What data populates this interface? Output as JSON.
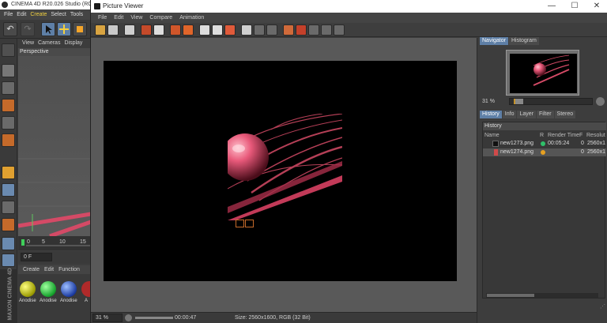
{
  "c4d": {
    "title": "CINEMA 4D R20.026 Studio (RC -",
    "menu": [
      "File",
      "Edit",
      "Create",
      "Select",
      "Tools"
    ],
    "viewport_menu": [
      "View",
      "Cameras",
      "Display"
    ],
    "viewport_label": "Perspective",
    "timeline_ticks": [
      "0",
      "5",
      "10",
      "15"
    ],
    "frame_value": "0 F",
    "materials_menu": [
      "Create",
      "Edit",
      "Function"
    ],
    "material_labels": [
      "Anodise",
      "Anodise",
      "Anodise",
      "A"
    ],
    "maxon_text": "MAXON CINEMA 4D"
  },
  "viewer": {
    "title": "Picture Viewer",
    "window_controls": [
      "—",
      "☐",
      "✕"
    ],
    "menu": [
      "File",
      "Edit",
      "View",
      "Compare",
      "Animation"
    ],
    "status": {
      "zoom": "31 %",
      "time": "00:00:47",
      "size": "Size: 2560x1600, RGB (32 Bit)"
    }
  },
  "panel": {
    "top_tabs": [
      "Navigator",
      "Histogram"
    ],
    "nav_zoom": "31 %",
    "nav_zoom_fraction": 0.05,
    "tabs": [
      "History",
      "Info",
      "Layer",
      "Filter",
      "Stereo"
    ],
    "history_header": "History",
    "columns": [
      "Name",
      "R",
      "Render Time",
      "F",
      "Resolut"
    ],
    "rows": [
      {
        "name": "new1273.png",
        "time": "00:05:24",
        "frame": "0",
        "res": "2560x1",
        "dot": "#2fc06a"
      },
      {
        "name": "new1274.png",
        "time": "",
        "frame": "0",
        "res": "2560x1",
        "dot": "#e6a021"
      }
    ]
  },
  "colors": {
    "accent": "#5e7fa6",
    "selection_orange": "#c56a2a",
    "render_pink": "#e8597a"
  }
}
